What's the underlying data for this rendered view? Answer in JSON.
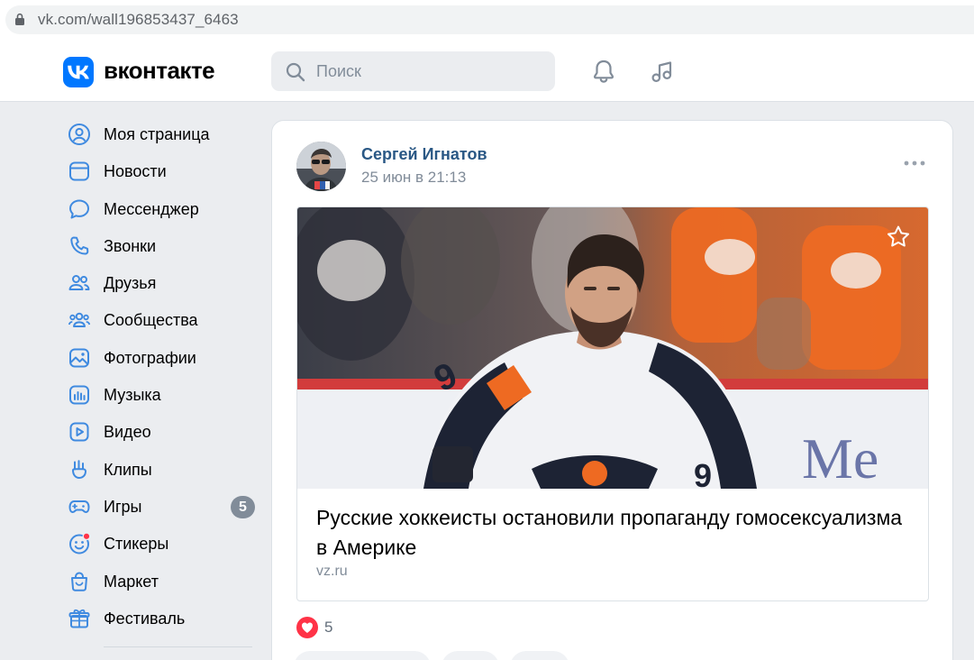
{
  "browser": {
    "url": "vk.com/wall196853437_6463"
  },
  "header": {
    "logo_text": "вконтакте",
    "search_placeholder": "Поиск",
    "brand_color": "#0077ff"
  },
  "sidebar": {
    "items": [
      {
        "label": "Моя страница",
        "icon": "user-circle-icon"
      },
      {
        "label": "Новости",
        "icon": "news-icon"
      },
      {
        "label": "Мессенджер",
        "icon": "message-bubble-icon"
      },
      {
        "label": "Звонки",
        "icon": "phone-icon"
      },
      {
        "label": "Друзья",
        "icon": "friends-icon"
      },
      {
        "label": "Сообщества",
        "icon": "communities-icon"
      },
      {
        "label": "Фотографии",
        "icon": "photo-icon"
      },
      {
        "label": "Музыка",
        "icon": "music-icon"
      },
      {
        "label": "Видео",
        "icon": "video-icon"
      },
      {
        "label": "Клипы",
        "icon": "clips-icon"
      },
      {
        "label": "Игры",
        "icon": "gamepad-icon",
        "badge": "5"
      },
      {
        "label": "Стикеры",
        "icon": "sticker-icon"
      },
      {
        "label": "Маркет",
        "icon": "market-bag-icon"
      },
      {
        "label": "Фестиваль",
        "icon": "gift-icon"
      }
    ]
  },
  "post": {
    "author": "Сергей Игнатов",
    "date": "25 июн в 21:13",
    "link": {
      "title": "Русские хоккеисты остановили пропаганду гомосексуализма в Америке",
      "domain": "vz.ru"
    },
    "likes": "5",
    "like_color": "#ff3347",
    "author_color": "#2a5885"
  }
}
